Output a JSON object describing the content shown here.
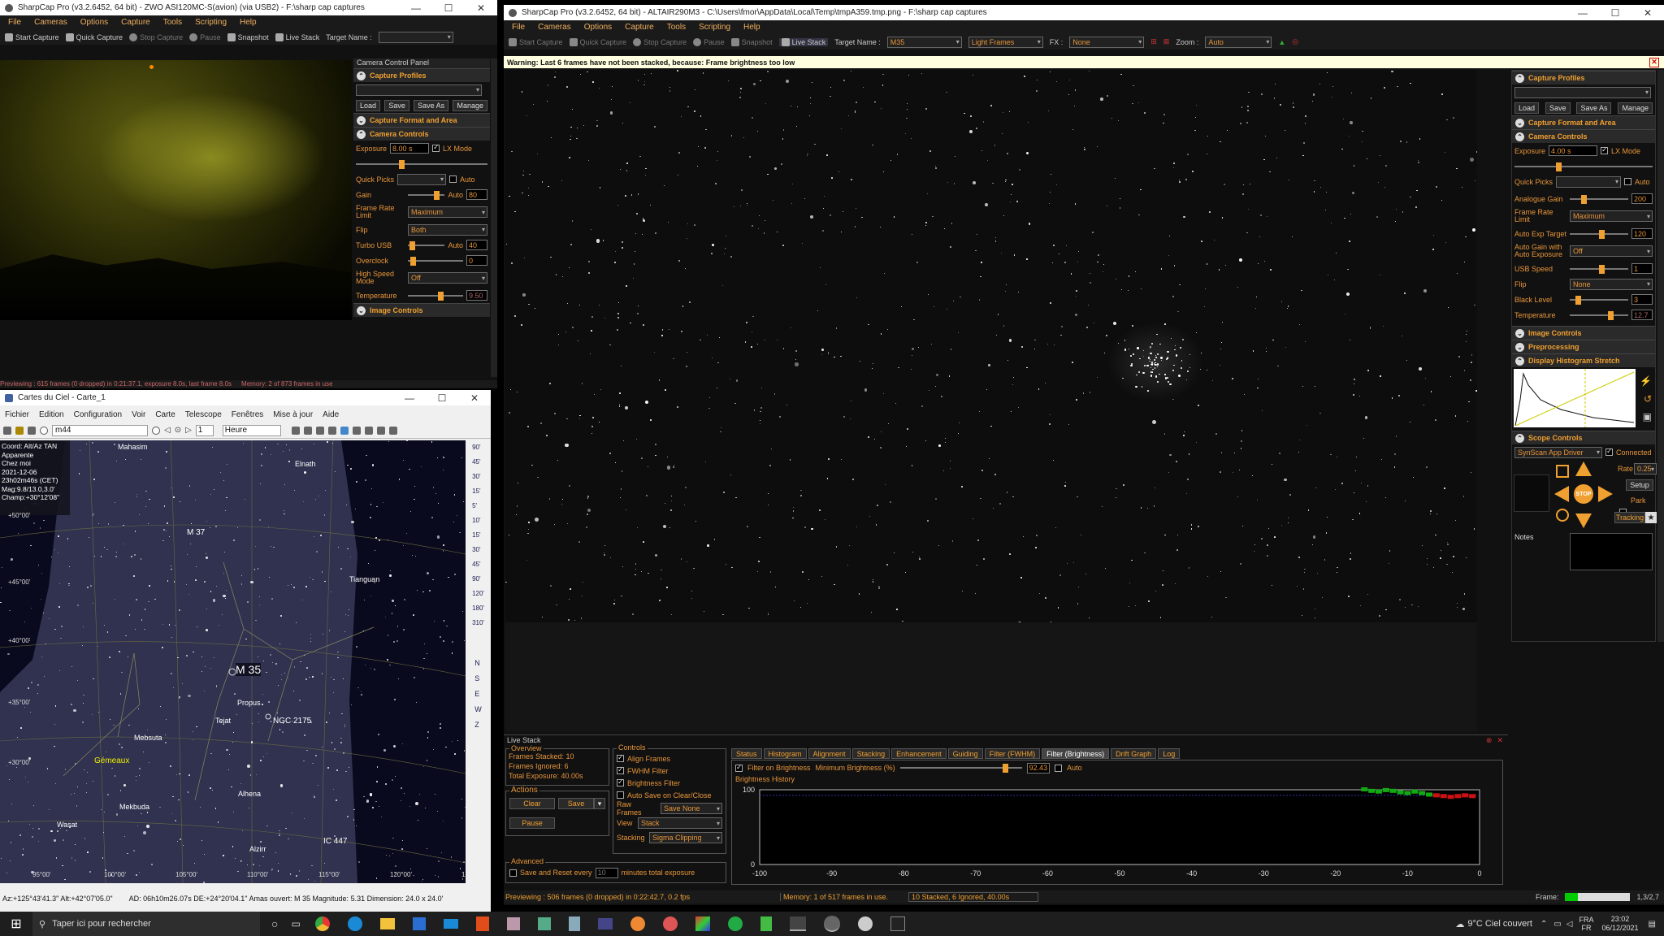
{
  "left_window": {
    "title": "SharpCap Pro (v3.2.6452, 64 bit) - ZWO ASI120MC-S(avion) (via USB2) - F:\\sharp cap captures",
    "menu": [
      "File",
      "Cameras",
      "Options",
      "Capture",
      "Tools",
      "Scripting",
      "Help"
    ],
    "toolbar": {
      "start": "Start Capture",
      "quick": "Quick Capture",
      "stop": "Stop Capture",
      "pause": "Pause",
      "snapshot": "Snapshot",
      "live": "Live Stack",
      "target": "Target Name :"
    },
    "panel_title": "Camera Control Panel",
    "sections": {
      "profiles": "Capture Profiles",
      "format": "Capture Format and Area",
      "controls": "Camera Controls",
      "image": "Image Controls"
    },
    "profile_buttons": [
      "Load",
      "Save",
      "Save As",
      "Manage"
    ],
    "exposure": {
      "label": "Exposure",
      "value": "8.00 s",
      "lx": "LX Mode",
      "slider": 0.33
    },
    "quick_picks": {
      "label": "Quick Picks",
      "auto": "Auto"
    },
    "gain": {
      "label": "Gain",
      "auto": "Auto",
      "value": "80",
      "slider": 0.7
    },
    "frame_rate": {
      "label": "Frame Rate Limit",
      "value": "Maximum"
    },
    "flip": {
      "label": "Flip",
      "value": "Both"
    },
    "turbo": {
      "label": "Turbo USB",
      "auto": "Auto",
      "value": "40",
      "slider": 0.05
    },
    "overclock": {
      "label": "Overclock",
      "value": "0",
      "slider": 0.05
    },
    "high_speed": {
      "label": "High Speed Mode",
      "value": "Off"
    },
    "temperature": {
      "label": "Temperature",
      "value": "9.50",
      "slider": 0.55
    },
    "status": "Previewing : 615 frames (0 dropped) in 0:21:37.1, exposure 8.0s, last frame 8.0s",
    "memory": "Memory: 2 of 873 frames in use",
    "frame_label": "Frame:"
  },
  "cdc_window": {
    "title": "Cartes du Ciel - Carte_1",
    "menu": [
      "Fichier",
      "Edition",
      "Configuration",
      "Voir",
      "Carte",
      "Telescope",
      "Fenêtres",
      "Mise à jour",
      "Aide"
    ],
    "search": "m44",
    "step": "1",
    "unit": "Heure",
    "info": [
      "Coord: Alt/Az TAN",
      "Apparente",
      "Chez moi",
      "2021-12-06",
      "23h02m46s (CET)",
      "Mag:9.8/13.0,3.0'",
      "Champ:+30°12'08\""
    ],
    "labels": {
      "m35": "M 35",
      "m37": "M 37",
      "propus": "Propus",
      "tejat": "Tejat",
      "ngc": "NGC 2175",
      "mebsuta": "Mebsuta",
      "gemeaux": "Gémeaux",
      "mekbuda": "Mekbuda",
      "alhena": "Alhena",
      "wasat": "Wasat",
      "alzirr": "Alzirr",
      "ic447": "IC 447",
      "elnath": "Elnath",
      "tianguan": "Tianguan",
      "mahasim": "Mahasim"
    },
    "dec_ticks": [
      "+50°00'",
      "+45°00'",
      "+40°00'",
      "+35°00'",
      "+30°00'"
    ],
    "ra_ticks": [
      "95°00'",
      "100°00'",
      "105°00'",
      "110°00'",
      "115°00'",
      "120°00'",
      "125°00'"
    ],
    "right_scale": [
      "90'",
      "45'",
      "30'",
      "15'",
      "5'",
      "10'",
      "15'",
      "30'",
      "45'",
      "90'",
      "120'",
      "180'",
      "310'"
    ],
    "right_letters": [
      "N",
      "S",
      "E",
      "W",
      "Z"
    ],
    "status": "Az:+125°43'41.3\" Alt:+42°07'05.0\"",
    "status2": "AD: 06h10m26.07s DE:+24°20'04.1\"  Amas ouvert: M 35  Magnitude: 5.31  Dimension: 24.0 x 24.0'"
  },
  "right_window": {
    "title": "SharpCap Pro (v3.2.6452, 64 bit) - ALTAIR290M3 - C:\\Users\\fmor\\AppData\\Local\\Temp\\tmpA359.tmp.png - F:\\sharp cap captures",
    "menu": [
      "File",
      "Cameras",
      "Options",
      "Capture",
      "Tools",
      "Scripting",
      "Help"
    ],
    "toolbar": {
      "start": "Start Capture",
      "quick": "Quick Capture",
      "stop": "Stop Capture",
      "pause": "Pause",
      "snapshot": "Snapshot",
      "live": "Live Stack",
      "target": "Target Name :",
      "target_value": "M35",
      "frames": "Light Frames",
      "fx": "FX :",
      "fx_value": "None",
      "zoom": "Zoom :",
      "zoom_value": "Auto"
    },
    "warning": "Warning: Last 6 frames have not been stacked, because: Frame brightness too low",
    "sections": {
      "profiles": "Capture Profiles",
      "format": "Capture Format and Area",
      "controls": "Camera Controls",
      "image": "Image Controls",
      "preprocessing": "Preprocessing",
      "histogram": "Display Histogram Stretch",
      "scope": "Scope Controls"
    },
    "profile_buttons": [
      "Load",
      "Save",
      "Save As",
      "Manage"
    ],
    "exposure": {
      "label": "Exposure",
      "value": "4.00 s",
      "lx": "LX Mode",
      "slider": 0.3
    },
    "quick_picks": {
      "label": "Quick Picks",
      "auto": "Auto"
    },
    "analogue_gain": {
      "label": "Analogue Gain",
      "value": "200",
      "slider": 0.2
    },
    "frame_rate": {
      "label": "Frame Rate Limit",
      "value": "Maximum"
    },
    "auto_exp": {
      "label": "Auto Exp Target",
      "value": "120",
      "slider": 0.5
    },
    "auto_gain": {
      "label": "Auto Gain with Auto Exposure",
      "value": "Off"
    },
    "usb_speed": {
      "label": "USB Speed",
      "value": "1",
      "slider": 0.5
    },
    "flip": {
      "label": "Flip",
      "value": "None"
    },
    "black_level": {
      "label": "Black Level",
      "value": "3",
      "slider": 0.1
    },
    "temperature": {
      "label": "Temperature",
      "value": "12.7",
      "slider": 0.65
    },
    "scope": {
      "driver": "SynScan App Driver",
      "connected": "Connected",
      "rate": "Rate",
      "rate_value": "0.25",
      "setup": "Setup",
      "park": "Park",
      "tracking": "Tracking",
      "stop": "STOP"
    },
    "notes": "Notes",
    "livestack": {
      "title": "Live Stack",
      "overview": "Overview",
      "frames_stacked": "Frames Stacked: 10",
      "frames_ignored": "Frames Ignored: 6",
      "total_exposure": "Total Exposure: 40.00s",
      "actions": "Actions",
      "clear": "Clear",
      "save": "Save",
      "pause": "Pause",
      "controls": "Controls",
      "align": "Align Frames",
      "fwhm": "FWHM Filter",
      "brightness": "Brightness Filter",
      "autosave": "Auto Save on Clear/Close",
      "raw_frames": "Raw Frames",
      "raw_value": "Save None",
      "view": "View",
      "view_value": "Stack",
      "stacking": "Stacking",
      "stacking_value": "Sigma Clipping",
      "advanced": "Advanced",
      "save_reset": "Save and Reset every",
      "minutes_value": "10",
      "minutes": "minutes total exposure",
      "tabs": [
        "Status",
        "Histogram",
        "Alignment",
        "Stacking",
        "Enhancement",
        "Guiding",
        "Filter (FWHM)",
        "Filter (Brightness)",
        "Drift Graph",
        "Log"
      ],
      "filter_on": "Filter on Brightness",
      "min_brightness": "Minimum Brightness (%)",
      "min_value": "92.43",
      "auto": "Auto",
      "history": "Brightness History",
      "y_ticks": [
        "100",
        "0"
      ],
      "x_ticks": [
        "-100",
        "-90",
        "-80",
        "-70",
        "-60",
        "-50",
        "-40",
        "-30",
        "-20",
        "-10",
        "0"
      ]
    },
    "status": "Previewing : 506 frames (0 dropped) in 0:22:42.7, 0.2 fps",
    "memory": "Memory: 1 of 517 frames in use.",
    "stacked": "10 Stacked, 6 Ignored, 40.00s",
    "frame_label": "Frame:",
    "frame_value": "1,3/2,7"
  },
  "taskbar": {
    "search": "Taper ici pour rechercher",
    "weather": "9°C  Ciel couvert",
    "lang": "FRA",
    "lang2": "FR",
    "time": "23:02",
    "date": "06/12/2021"
  },
  "chart_data": {
    "type": "bar",
    "title": "Brightness History",
    "x_ticks": [
      -100,
      -90,
      -80,
      -70,
      -60,
      -50,
      -40,
      -30,
      -20,
      -10,
      0
    ],
    "ylim": [
      0,
      100
    ],
    "threshold": 92.43,
    "series": [
      {
        "name": "",
        "x": [
          -16,
          -15,
          -14,
          -13,
          -12,
          -11,
          -10,
          -9,
          -8,
          -7,
          -6,
          -5,
          -4,
          -3,
          -2,
          -1
        ],
        "values": [
          100,
          98,
          97,
          99,
          98,
          96,
          95,
          97,
          95,
          93,
          92,
          91,
          90,
          91,
          92,
          91
        ]
      }
    ]
  }
}
